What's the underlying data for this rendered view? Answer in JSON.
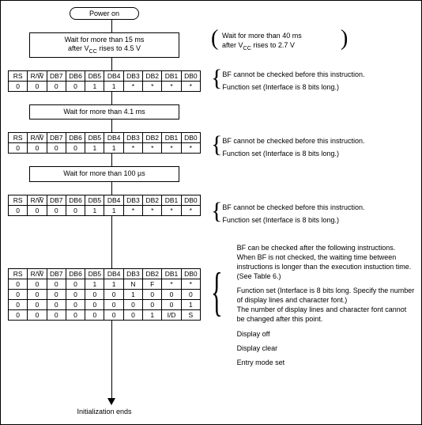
{
  "start": {
    "label": "Power on"
  },
  "left": {
    "box1a": "Wait for more than 15 ms",
    "box1b_pre": "after V",
    "box1b_sub": "CC",
    "box1b_post": " rises to 4.5 V",
    "box2": "Wait for more than 4.1 ms",
    "box3": "Wait for more than 100 µs",
    "end": "Initialization ends"
  },
  "tableHeader": [
    "RS",
    "R/W̅",
    "DB7",
    "DB6",
    "DB5",
    "DB4",
    "DB3",
    "DB2",
    "DB1",
    "DB0"
  ],
  "row_funcset": [
    "0",
    "0",
    "0",
    "0",
    "1",
    "1",
    "*",
    "*",
    "*",
    "*"
  ],
  "finalRows": [
    [
      "0",
      "0",
      "0",
      "0",
      "1",
      "1",
      "N",
      "F",
      "*",
      "*"
    ],
    [
      "0",
      "0",
      "0",
      "0",
      "0",
      "0",
      "1",
      "0",
      "0",
      "0"
    ],
    [
      "0",
      "0",
      "0",
      "0",
      "0",
      "0",
      "0",
      "0",
      "0",
      "1"
    ],
    [
      "0",
      "0",
      "0",
      "0",
      "0",
      "0",
      "0",
      "1",
      "I/D",
      "S"
    ]
  ],
  "right": {
    "alt_a": "Wait for more than 40 ms",
    "alt_b_pre": "after V",
    "alt_b_sub": "CC",
    "alt_b_post": " rises to 2.7 V",
    "bf_no": "BF cannot be checked before this instruction.",
    "func8": "Function set  (Interface is 8 bits long.)",
    "bf_yes": "BF can be checked after the following instructions. When BF is not checked, the waiting time between instructions is longer than the execution instuction time.  (See Table 6.)",
    "func8_full": "Function set  (Interface is 8 bits long.  Specify the number of display lines and character font.)",
    "func8_note": "The number of display lines and character font cannot be changed after this point.",
    "disp_off": "Display off",
    "disp_clear": "Display clear",
    "entry": "Entry mode set"
  }
}
